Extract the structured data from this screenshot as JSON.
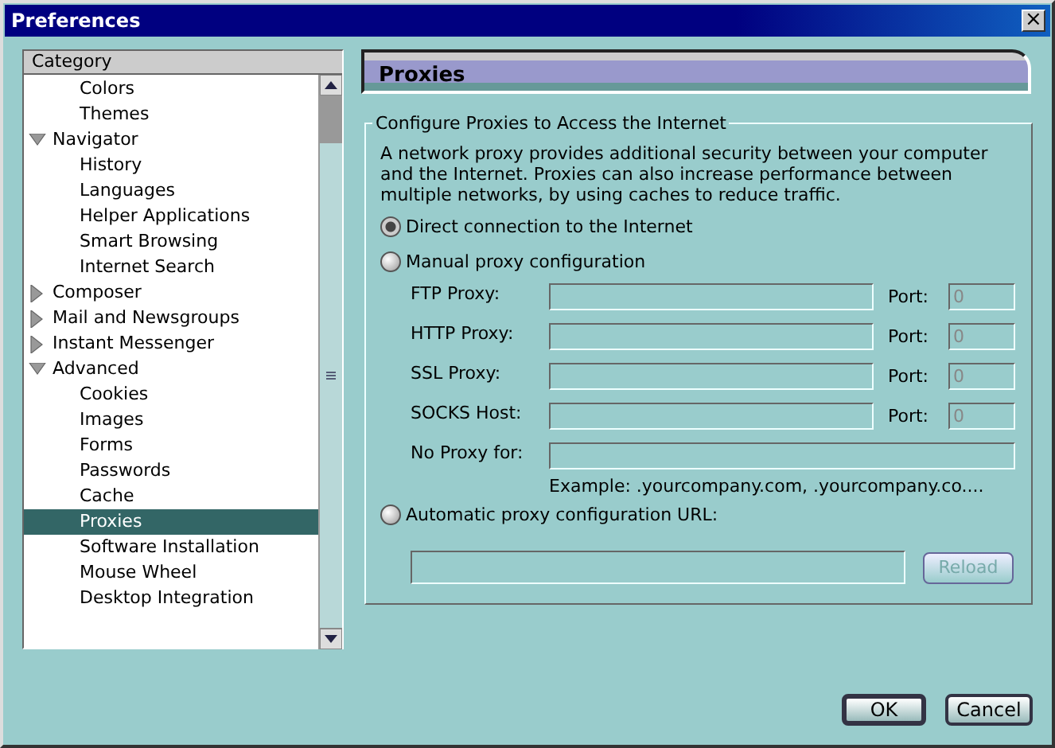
{
  "window": {
    "title": "Preferences",
    "close": "×"
  },
  "sidebar": {
    "header": "Category",
    "items": [
      {
        "children": [
          {
            "label": "Colors",
            "selected": false
          },
          {
            "label": "Themes",
            "selected": false
          }
        ]
      },
      {
        "label": "Navigator",
        "selected": false,
        "expanded": true,
        "children": [
          {
            "label": "History",
            "selected": false
          },
          {
            "label": "Languages",
            "selected": false
          },
          {
            "label": "Helper Applications",
            "selected": false
          },
          {
            "label": "Smart Browsing",
            "selected": false
          },
          {
            "label": "Internet Search",
            "selected": false
          }
        ]
      },
      {
        "label": "Composer",
        "selected": false,
        "expanded": false
      },
      {
        "label": "Mail and Newsgroups",
        "selected": false,
        "expanded": false
      },
      {
        "label": "Instant Messenger",
        "selected": false,
        "expanded": false
      },
      {
        "label": "Advanced",
        "selected": false,
        "expanded": true,
        "children": [
          {
            "label": "Cookies",
            "selected": false
          },
          {
            "label": "Images",
            "selected": false
          },
          {
            "label": "Forms",
            "selected": false
          },
          {
            "label": "Passwords",
            "selected": false
          },
          {
            "label": "Cache",
            "selected": false
          },
          {
            "label": "Proxies",
            "selected": true
          },
          {
            "label": "Software Installation",
            "selected": false
          },
          {
            "label": "Mouse Wheel",
            "selected": false
          },
          {
            "label": "Desktop Integration",
            "selected": false
          }
        ]
      }
    ]
  },
  "panel": {
    "title": "Proxies",
    "group_title": "Configure Proxies to Access the Internet",
    "description": "A network proxy provides additional security between your computer and the Internet. Proxies can also increase performance between multiple networks, by using caches to reduce traffic.",
    "direct_option": {
      "label": "Direct connection to the Internet",
      "selected": true
    },
    "manual_option": {
      "label": "Manual proxy configuration",
      "selected": false
    },
    "proxies": [
      {
        "label": "FTP Proxy:",
        "disabled": true,
        "port_label": "Port:",
        "port_value": "0"
      },
      {
        "label": "HTTP Proxy:",
        "disabled": true,
        "port_label": "Port:",
        "port_value": "0"
      },
      {
        "label": "SSL Proxy:",
        "disabled": true,
        "port_label": "Port:",
        "port_value": "0"
      },
      {
        "label": "SOCKS Host:",
        "disabled": true,
        "port_label": "Port:",
        "port_value": "0"
      }
    ],
    "no_proxy": {
      "label": "No Proxy for:",
      "disabled": true
    },
    "example": "Example: .yourcompany.com, .yourcompany.co....",
    "auto_option": {
      "label": "Automatic proxy configuration URL:",
      "selected": false
    },
    "auto_url": {
      "disabled": true
    },
    "reload_button": {
      "label": "Reload",
      "disabled": true
    }
  },
  "buttons": [
    {
      "label": "OK",
      "default": true
    },
    {
      "label": "Cancel",
      "default": false
    }
  ]
}
